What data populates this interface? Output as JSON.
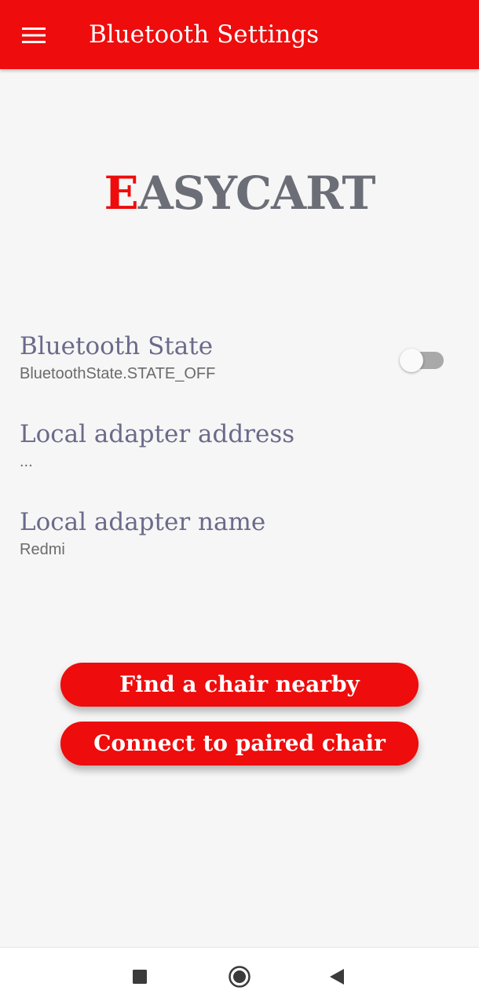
{
  "app_bar": {
    "title": "Bluetooth Settings",
    "menu_icon": "hamburger-menu-icon",
    "background_color": "#ee0c0c"
  },
  "logo": {
    "first_letter": "E",
    "rest": "ASYCART",
    "accent_color": "#ee0c0c",
    "text_color": "#6b6e77"
  },
  "settings": [
    {
      "title": "Bluetooth State",
      "value": "BluetoothState.STATE_OFF"
    },
    {
      "title": "Local adapter address",
      "value": "..."
    },
    {
      "title": "Local adapter name",
      "value": "Redmi"
    }
  ],
  "bluetooth_toggle": {
    "on": false
  },
  "buttons": {
    "find_chair": "Find a chair nearby",
    "connect_paired": "Connect to paired chair"
  },
  "nav_bar": {
    "recents_icon": "square-recents-icon",
    "home_icon": "circle-home-icon",
    "back_icon": "triangle-back-icon"
  }
}
